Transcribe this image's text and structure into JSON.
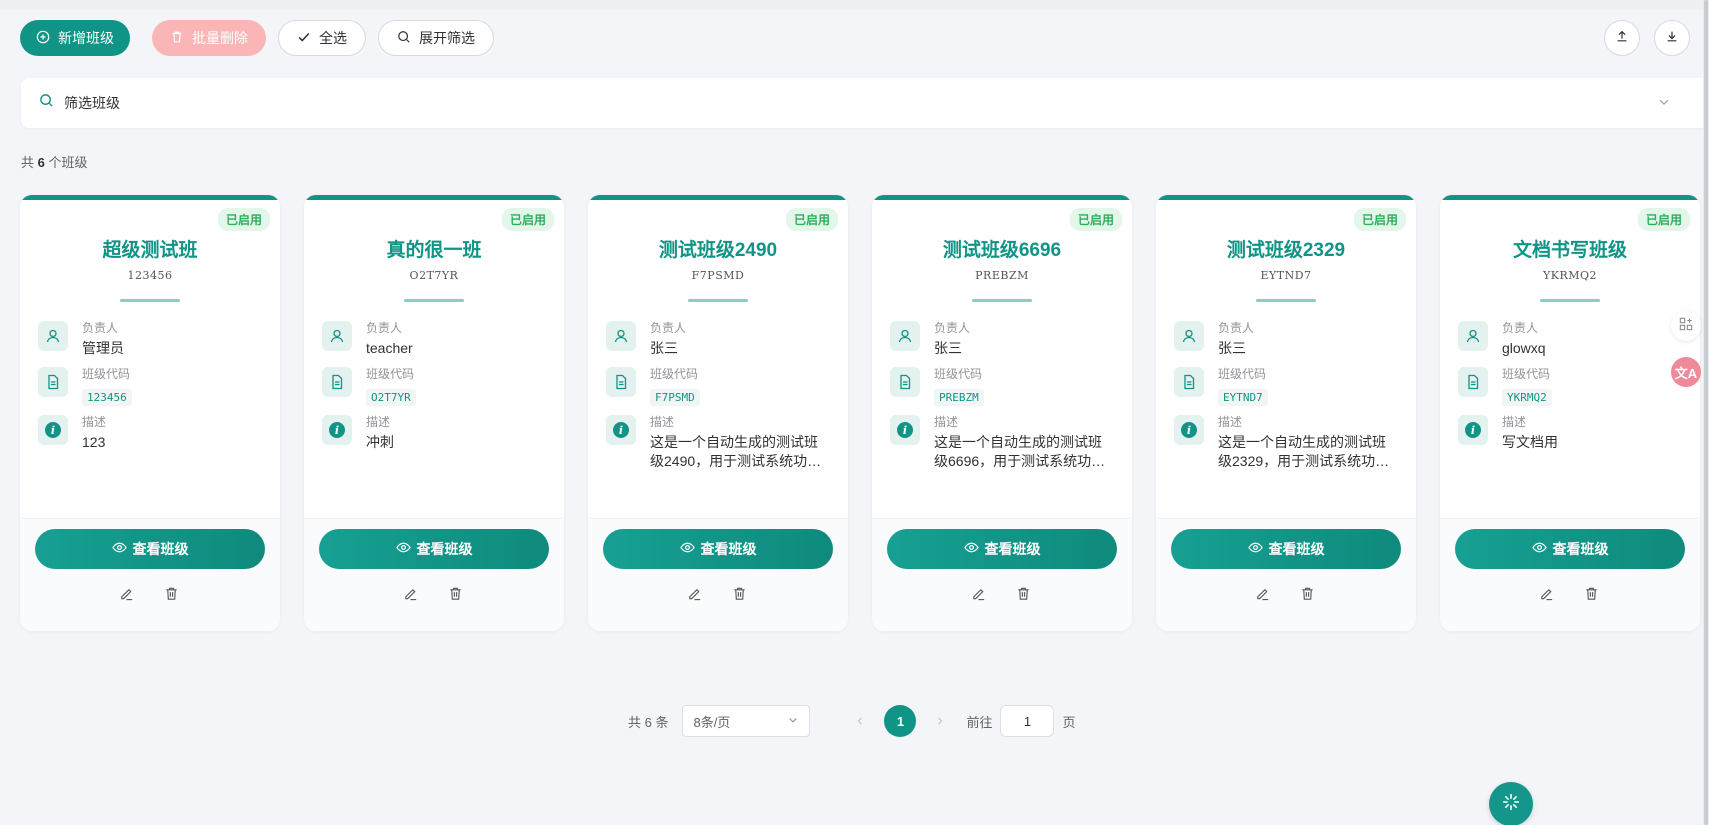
{
  "toolbar": {
    "add_label": "新增班级",
    "batch_delete_label": "批量删除",
    "select_all_label": "全选",
    "expand_filter_label": "展开筛选",
    "upload_icon": "upload-icon",
    "download_icon": "download-icon"
  },
  "search": {
    "label": "筛选班级"
  },
  "summary": {
    "prefix": "共",
    "count": "6",
    "suffix": "个班级"
  },
  "field_labels": {
    "owner": "负责人",
    "code": "班级代码",
    "desc": "描述"
  },
  "card_actions": {
    "view_label": "查看班级"
  },
  "classes": [
    {
      "status": "已启用",
      "name": "超级测试班",
      "code": "123456",
      "owner": "管理员",
      "desc": "123"
    },
    {
      "status": "已启用",
      "name": "真的很一班",
      "code": "O2T7YR",
      "owner": "teacher",
      "desc": "冲刺"
    },
    {
      "status": "已启用",
      "name": "测试班级2490",
      "code": "F7PSMD",
      "owner": "张三",
      "desc": "这是一个自动生成的测试班级2490，用于测试系统功…"
    },
    {
      "status": "已启用",
      "name": "测试班级6696",
      "code": "PREBZM",
      "owner": "张三",
      "desc": "这是一个自动生成的测试班级6696，用于测试系统功…"
    },
    {
      "status": "已启用",
      "name": "测试班级2329",
      "code": "EYTND7",
      "owner": "张三",
      "desc": "这是一个自动生成的测试班级2329，用于测试系统功…"
    },
    {
      "status": "已启用",
      "name": "文档书写班级",
      "code": "YKRMQ2",
      "owner": "glowxq",
      "desc": "写文档用"
    }
  ],
  "pagination": {
    "total": "共 6 条",
    "page_size": "8条/页",
    "current_page": "1",
    "goto_label": "前往",
    "goto_value": "1",
    "page_unit": "页"
  },
  "side_tools": {
    "translate_glyph": "文A"
  },
  "colors": {
    "primary": "#0f9486",
    "danger_disabled": "#fab6b6",
    "status_text": "#2fae5d"
  }
}
